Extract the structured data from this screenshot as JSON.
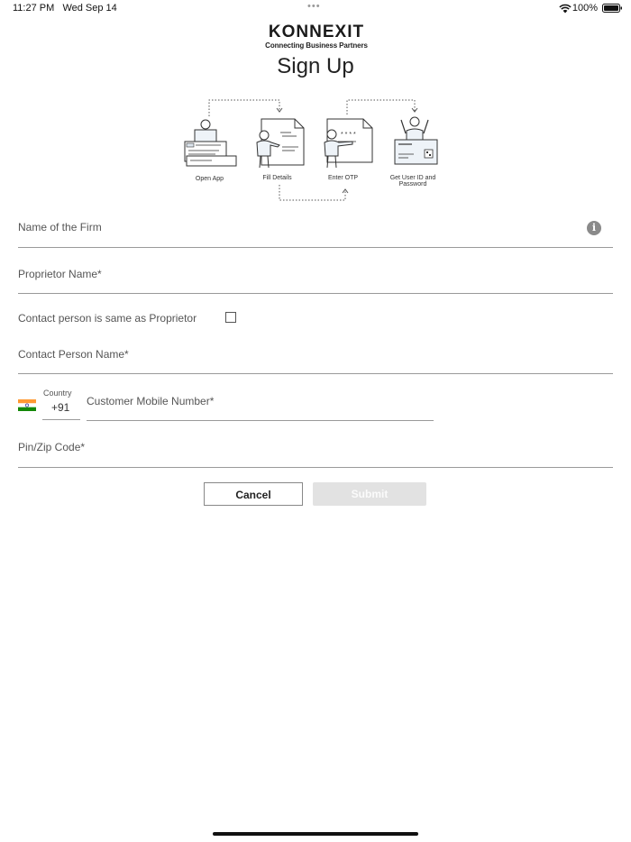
{
  "status_bar": {
    "time": "11:27 PM",
    "date": "Wed Sep 14",
    "dots": "•••",
    "battery_percent": "100%"
  },
  "header": {
    "logo_text": "KONNEXIT",
    "tagline": "Connecting Business Partners",
    "title": "Sign Up"
  },
  "steps": [
    {
      "label": "Open App"
    },
    {
      "label": "Fill Details"
    },
    {
      "label": "Enter OTP"
    },
    {
      "label_line1": "Get User ID and",
      "label_line2": "Password"
    }
  ],
  "form": {
    "firm_name_label": "Name of the Firm",
    "proprietor_label": "Proprietor Name*",
    "same_as_proprietor_label": "Contact person is same as Proprietor",
    "same_as_proprietor_checked": false,
    "contact_person_label": "Contact Person Name*",
    "country_label": "Country",
    "country_code": "+91",
    "mobile_label": "Customer Mobile Number*",
    "pin_label": "Pin/Zip Code*"
  },
  "buttons": {
    "cancel": "Cancel",
    "submit": "Submit"
  },
  "colors": {
    "flag_saffron": "#FF9933",
    "flag_green": "#138808",
    "submit_disabled_bg": "#e2e2e2"
  }
}
